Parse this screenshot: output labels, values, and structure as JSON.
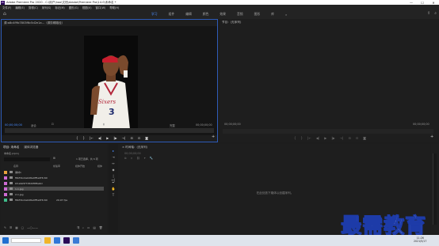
{
  "titlebar": {
    "logo": "Pr",
    "title": "Adobe Premiere Pro 2020 - C:\\用户\\hao\\文档\\Adobe\\Premiere Pro\\14.0\\未命名 *",
    "minimize": "—",
    "maximize": "☐",
    "close": "✕"
  },
  "menubar": [
    "文件(F)",
    "编辑(E)",
    "剪辑(C)",
    "序列(S)",
    "标记(M)",
    "图形(G)",
    "视图(V)",
    "窗口(W)",
    "帮助(H)"
  ],
  "workspace": {
    "tabs": [
      "学习",
      "组件",
      "编辑",
      "颜色",
      "效果",
      "音频",
      "图形",
      "库"
    ],
    "active_tab": "学习",
    "overflow": "»"
  },
  "source": {
    "path": "源:a8c4f9b7803f6c5d2e1a...（源剪辑路径）",
    "timecode_left": "00;00;00;00",
    "fit": "适合",
    "resolution": "完整",
    "timecode_right": "00;00;00;00",
    "controls": [
      "{",
      "}",
      "|←",
      "◀|",
      "▶",
      "|▶",
      "→|",
      "⊟",
      "⊡",
      "◙"
    ]
  },
  "program": {
    "header": "节目：(无序列)",
    "timecode_left": "00;00;00;00",
    "timecode_right": "00;00;00;00"
  },
  "project": {
    "tabs": [
      "项目: 未命名",
      "媒体浏览器"
    ],
    "project_name": "未命名.prproj",
    "columns": [
      "名称",
      "帧速率",
      "媒体开始",
      "媒体"
    ],
    "item_count": "1 项已选择，共 6 项",
    "rows": [
      {
        "name": "素材1",
        "fps": "",
        "color": "#e8a33c"
      },
      {
        "name": "f8bf3bc2ab98a4ff5a3f3c60",
        "fps": "",
        "color": "#cf6bd3"
      },
      {
        "name": "bfcafef2f738d0f8f6a6d",
        "fps": "",
        "color": "#cf6bd3"
      },
      {
        "name": "1-1.jpg",
        "fps": "",
        "color": "#cf6bd3"
      },
      {
        "name": "2-1.jpg",
        "fps": "",
        "color": "#cf6bd3"
      },
      {
        "name": "f8bf3bc2ab98a4ff5a3f3c60",
        "fps": "29.97 fps",
        "color": "#3fbe8b"
      }
    ]
  },
  "timeline": {
    "header": "× 时间轴：(无序列)",
    "timecode": "00;00;00;00",
    "empty_message": "在此处放下媒体以创建序列。"
  },
  "taskbar": {
    "time": "11:26",
    "date": "2021/5/17"
  },
  "watermark": "最需教育"
}
